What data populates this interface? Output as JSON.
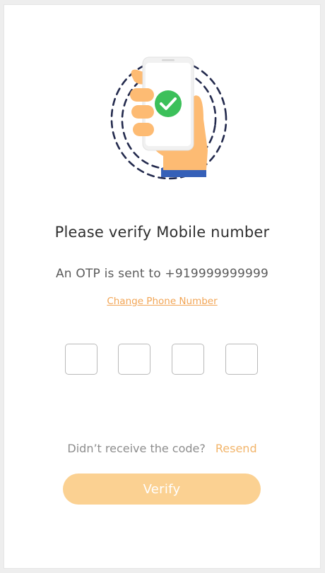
{
  "verify": {
    "title": "Please verify Mobile number",
    "otp_sent_text": "An OTP is sent to +919999999999",
    "change_phone_label": "Change Phone Number",
    "otp_digits": [
      "",
      "",
      "",
      ""
    ],
    "didnt_receive_text": "Didn’t receive the code?",
    "resend_label": "Resend",
    "verify_label": "Verify"
  },
  "colors": {
    "accent": "#f2a555",
    "button_bg": "#fbd192",
    "title_text": "#2f2f2f",
    "muted_text": "#8d8d8d",
    "check_green": "#3cc05a",
    "cuff_blue": "#3560b8",
    "hand_skin": "#fdbb73"
  }
}
